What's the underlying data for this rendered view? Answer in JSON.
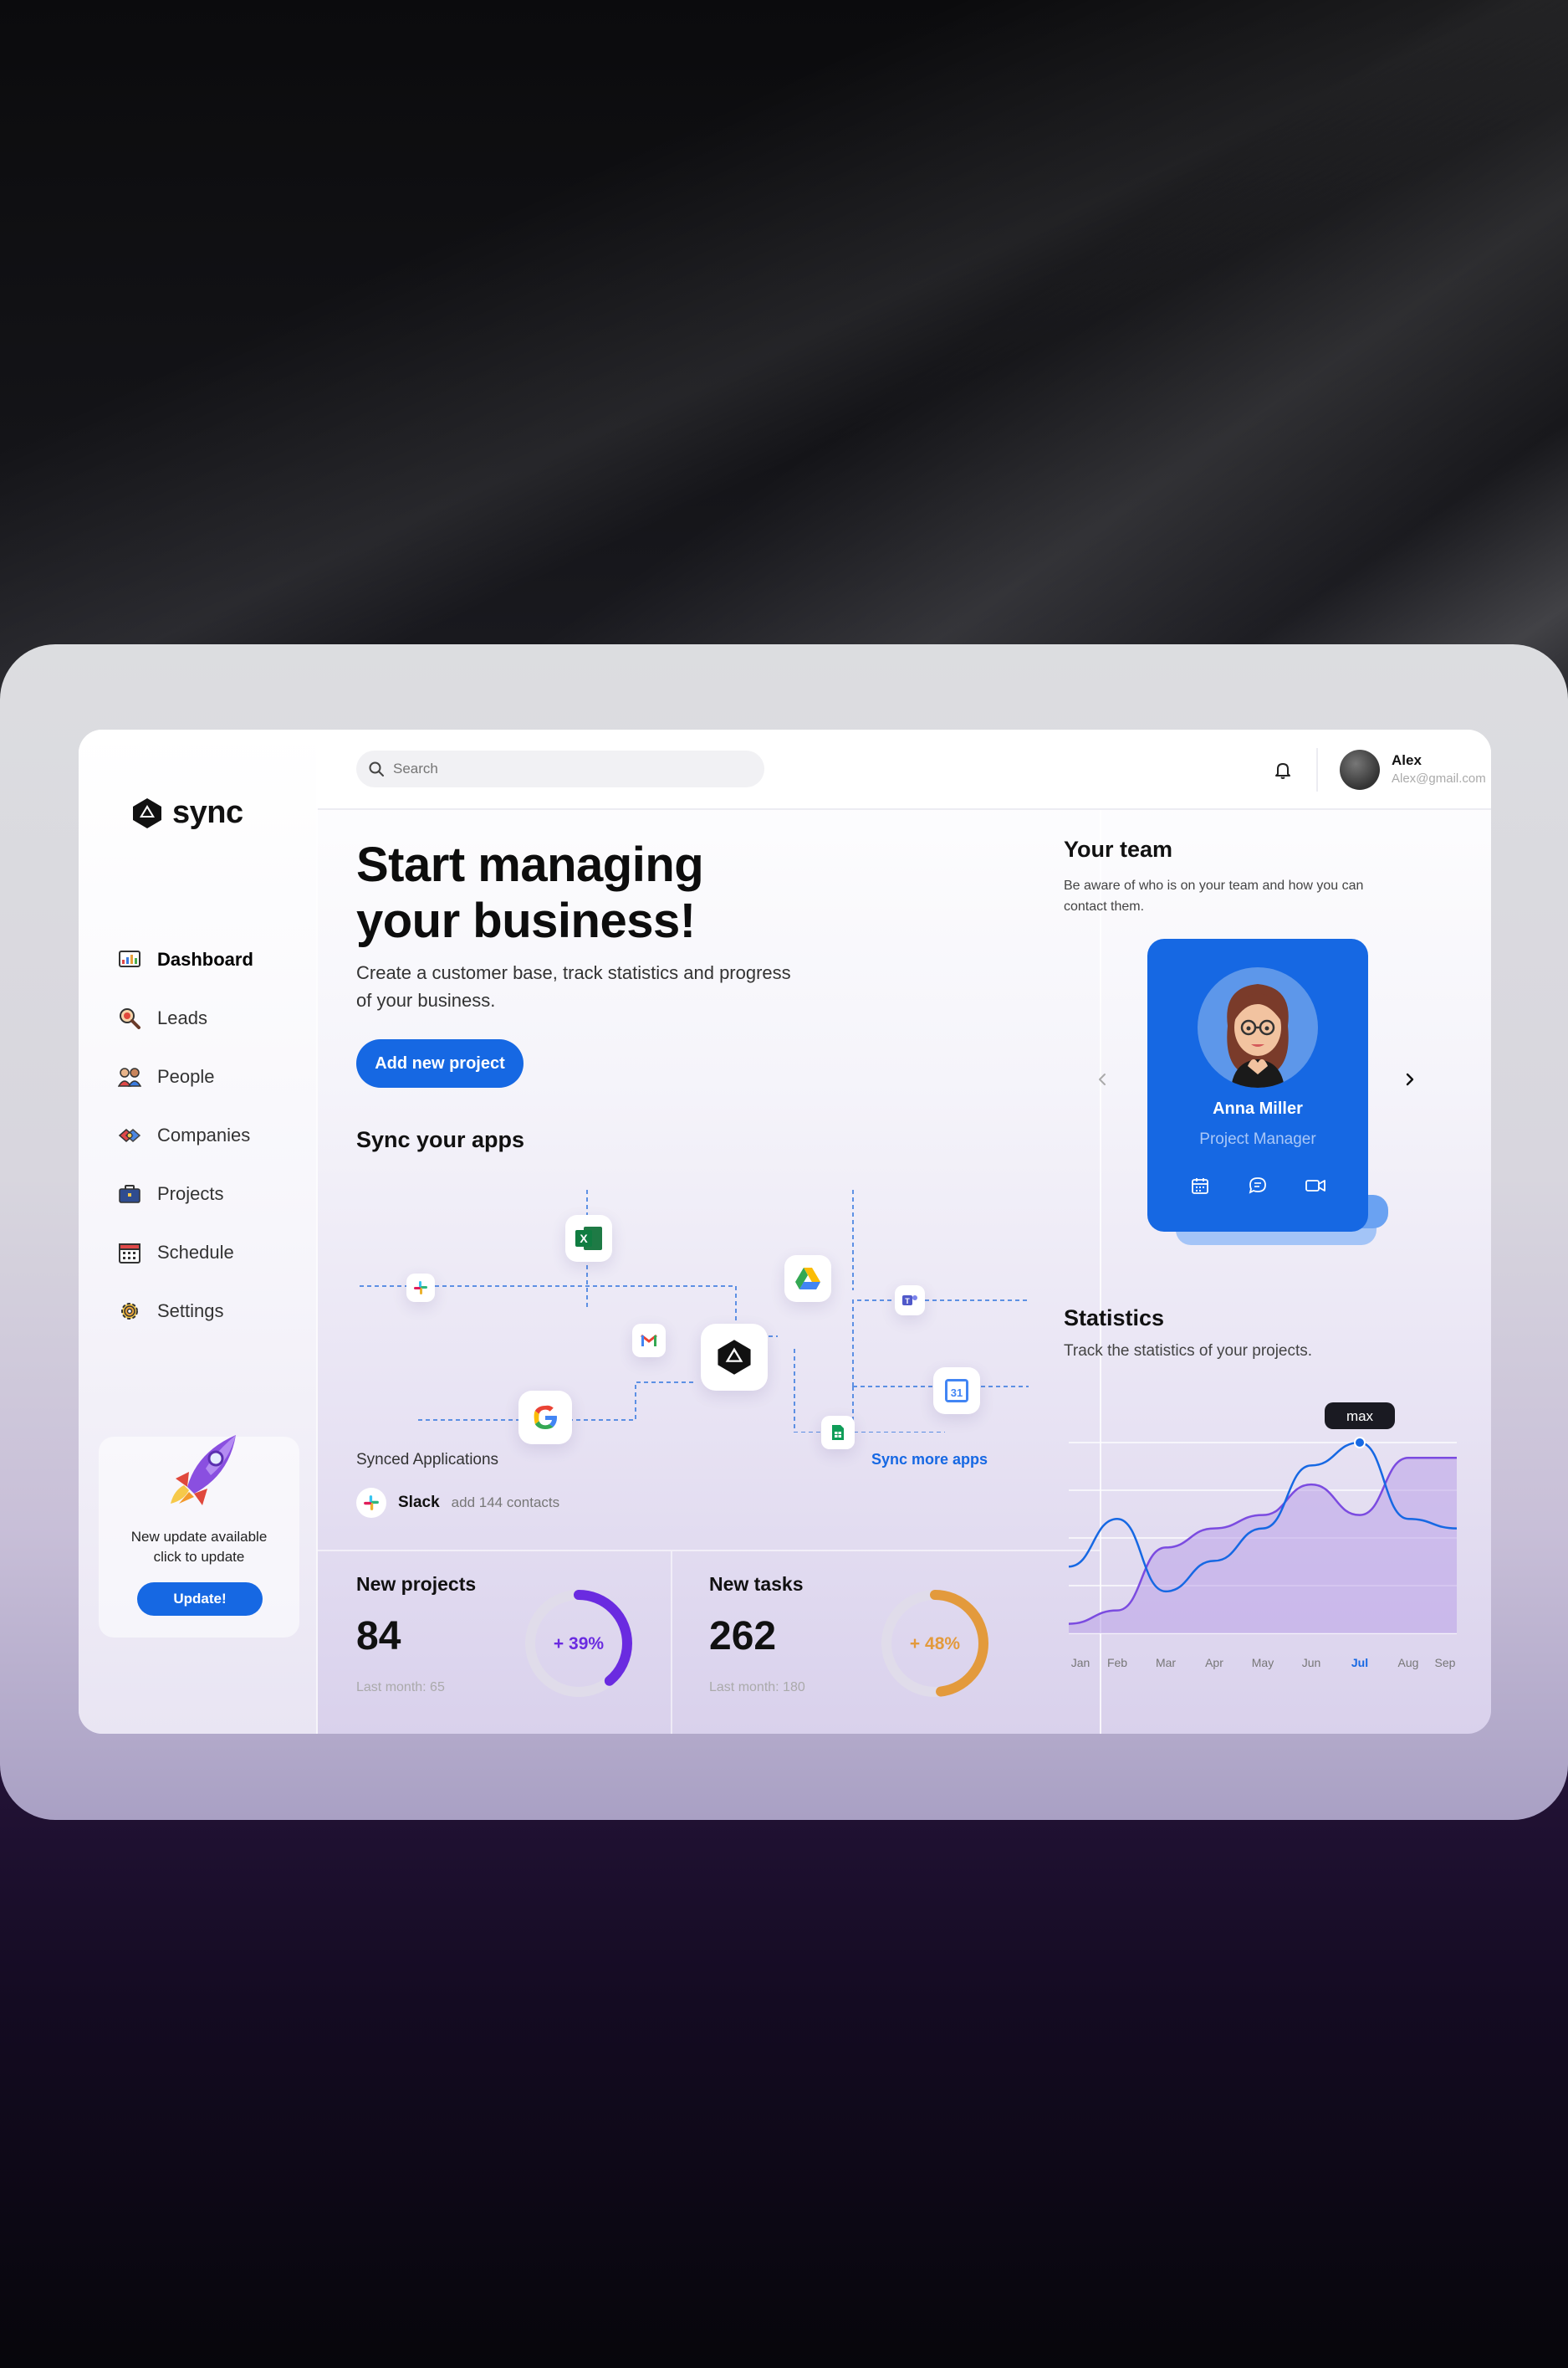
{
  "app": {
    "name": "sync"
  },
  "sidebar": {
    "items": [
      {
        "label": "Dashboard",
        "icon": "dashboard-icon",
        "active": true
      },
      {
        "label": "Leads",
        "icon": "magnifier-icon",
        "active": false
      },
      {
        "label": "People",
        "icon": "people-icon",
        "active": false
      },
      {
        "label": "Companies",
        "icon": "companies-icon",
        "active": false
      },
      {
        "label": "Projects",
        "icon": "briefcase-icon",
        "active": false
      },
      {
        "label": "Schedule",
        "icon": "calendar-icon",
        "active": false
      },
      {
        "label": "Settings",
        "icon": "gear-icon",
        "active": false
      }
    ],
    "update": {
      "text_line1": "New update available",
      "text_line2": "click to update",
      "button": "Update!"
    }
  },
  "topbar": {
    "search_placeholder": "Search",
    "user": {
      "name": "Alex",
      "email": "Alex@gmail.com"
    }
  },
  "hero": {
    "title_line1": "Start managing",
    "title_line2": "your business!",
    "subtitle": "Create a customer base, track statistics and progress of your business.",
    "button": "Add new project"
  },
  "sync": {
    "title": "Sync your apps",
    "apps": [
      "slack",
      "excel",
      "gmail",
      "google",
      "sync",
      "google-drive",
      "teams",
      "google-sheets",
      "google-calendar"
    ],
    "calendar_day": "31",
    "synced_label": "Synced Applications",
    "sync_more": "Sync more apps",
    "synced": {
      "name": "Slack",
      "detail": "add 144 contacts"
    }
  },
  "stats_cards": [
    {
      "title": "New projects",
      "value": "84",
      "change": "+ 39%",
      "change_fraction": 0.39,
      "last_month": "Last month: 65",
      "color": "#6a2be0"
    },
    {
      "title": "New tasks",
      "value": "262",
      "change": "+ 48%",
      "change_fraction": 0.48,
      "last_month": "Last month: 180",
      "color": "#e39a3c"
    }
  ],
  "team": {
    "title": "Your team",
    "subtitle": "Be aware of who is on your team and how you can contact them.",
    "member": {
      "name": "Anna Miller",
      "role": "Project Manager"
    }
  },
  "statistics": {
    "title": "Statistics",
    "subtitle": "Track the statistics of your projects.",
    "tooltip": "max",
    "highlight_month": "Jul"
  },
  "chart_data": {
    "type": "area",
    "categories": [
      "Jan",
      "Feb",
      "Mar",
      "Apr",
      "May",
      "Jun",
      "Jul",
      "Aug",
      "Sep"
    ],
    "series": [
      {
        "values": [
          0.05,
          0.12,
          0.45,
          0.55,
          0.62,
          0.78,
          0.62,
          0.92,
          0.92
        ]
      },
      {
        "values": [
          0.35,
          0.6,
          0.22,
          0.38,
          0.55,
          0.88,
          1.0,
          0.6,
          0.55
        ]
      }
    ],
    "ylim": [
      0,
      1
    ],
    "grid": true,
    "accent": "#1668e3",
    "line_color": "#7b4be0"
  }
}
